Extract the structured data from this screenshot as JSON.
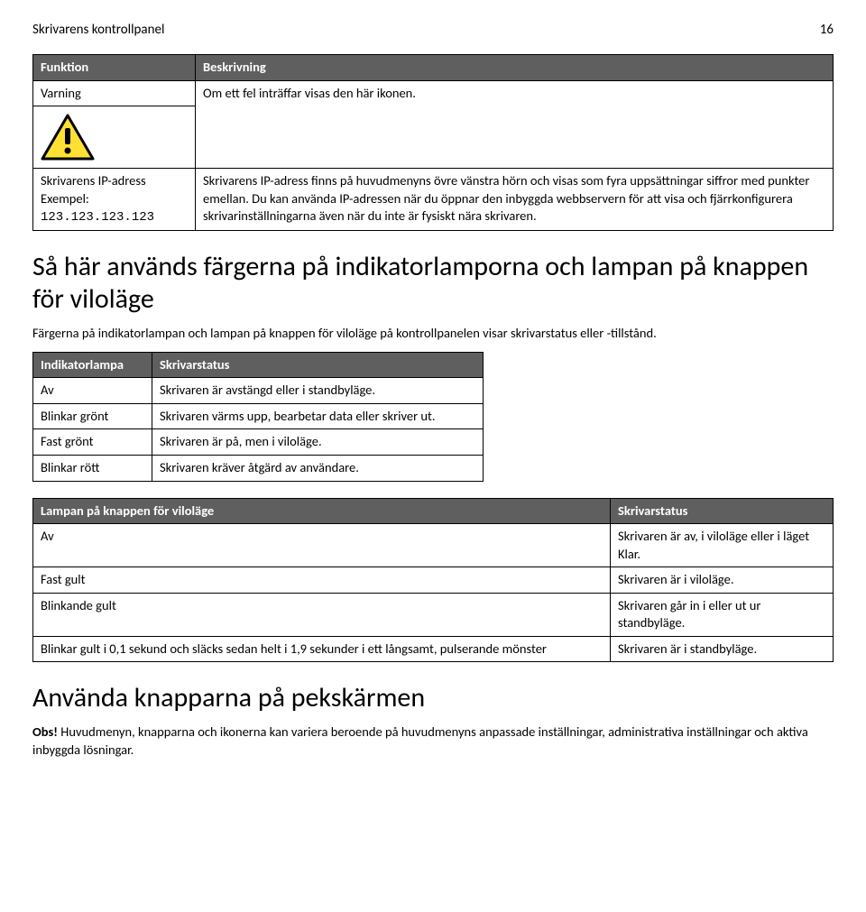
{
  "header": {
    "title": "Skrivarens kontrollpanel",
    "page_number": "16"
  },
  "table1": {
    "headers": {
      "col1": "Funktion",
      "col2": "Beskrivning"
    },
    "row1": {
      "label": "Varning",
      "desc": "Om ett fel inträffar visas den här ikonen."
    },
    "row2": {
      "label_line1": "Skrivarens IP-adress",
      "label_line2_prefix": "Exempel: ",
      "label_line2_value": "123.123.123.123",
      "desc": "Skrivarens IP-adress finns på huvudmenyns övre vänstra hörn och visas som fyra uppsättningar siffror med punkter emellan. Du kan använda IP-adressen när du öppnar den inbyggda webbservern för att visa och fjärrkonfigurera skrivarinställningarna även när du inte är fysiskt nära skrivaren."
    }
  },
  "section1": {
    "heading": "Så här används färgerna på indikatorlamporna och lampan på knappen för viloläge",
    "intro": "Färgerna på indikatorlampan och lampan på knappen för viloläge på kontrollpanelen visar skrivarstatus eller -tillstånd."
  },
  "table2": {
    "headers": {
      "col1": "Indikatorlampa",
      "col2": "Skrivarstatus"
    },
    "rows": [
      {
        "c1": "Av",
        "c2": "Skrivaren är avstängd eller i standbyläge."
      },
      {
        "c1": "Blinkar grönt",
        "c2": "Skrivaren värms upp, bearbetar data eller skriver ut."
      },
      {
        "c1": "Fast grönt",
        "c2": "Skrivaren är på, men i viloläge."
      },
      {
        "c1": "Blinkar rött",
        "c2": "Skrivaren kräver åtgärd av användare."
      }
    ]
  },
  "table3": {
    "headers": {
      "col1": "Lampan på knappen för viloläge",
      "col2": "Skrivarstatus"
    },
    "rows": [
      {
        "c1": "Av",
        "c2": "Skrivaren är av, i viloläge eller i läget Klar."
      },
      {
        "c1": "Fast gult",
        "c2": "Skrivaren är i viloläge."
      },
      {
        "c1": "Blinkande gult",
        "c2": "Skrivaren går in i eller ut ur standbyläge."
      },
      {
        "c1": "Blinkar gult i 0,1 sekund och släcks sedan helt i 1,9 sekunder i ett långsamt, pulserande mönster",
        "c2": "Skrivaren är i standbyläge."
      }
    ]
  },
  "section2": {
    "heading": "Använda knapparna på pekskärmen",
    "note_label": "Obs!",
    "note_text": " Huvudmenyn, knapparna och ikonerna kan variera beroende på huvudmenyns anpassade inställningar, administrativa inställningar och aktiva inbyggda lösningar."
  }
}
